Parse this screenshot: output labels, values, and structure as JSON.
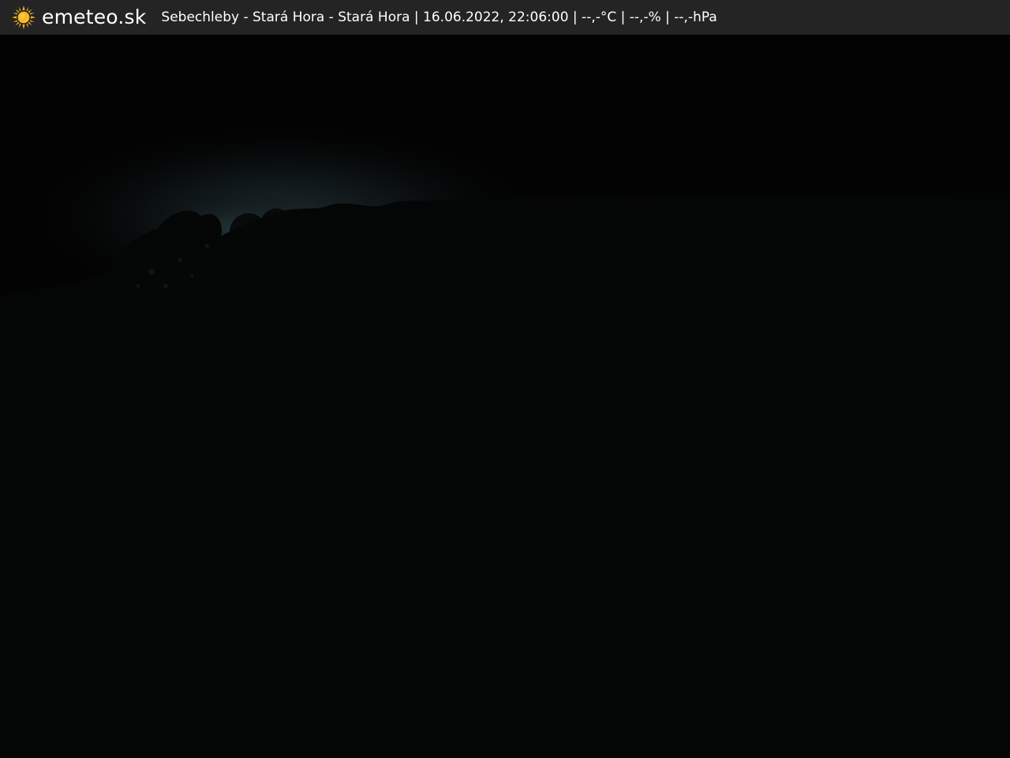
{
  "header": {
    "logo_text": "emeteo.sk",
    "logo_icon": "sun-icon",
    "caption": "Sebechleby - Stará Hora - Stará Hora | 16.06.2022, 22:06:00 | --,-°C | --,-% | --,-hPa"
  },
  "colors": {
    "bar_background": "#242424",
    "sun": "#f5b21e",
    "text": "#ffffff"
  }
}
